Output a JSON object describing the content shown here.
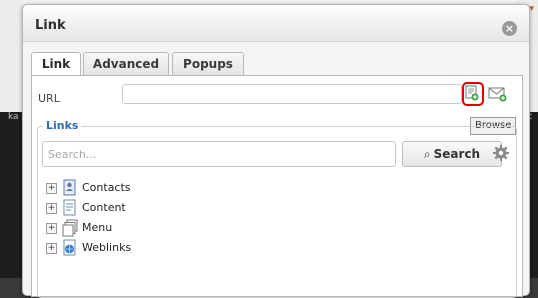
{
  "background": {
    "left_text": "ka",
    "right_text": "t"
  },
  "dialog": {
    "title": "Link",
    "close_glyph": "×"
  },
  "tabs": [
    {
      "label": "Link",
      "active": true
    },
    {
      "label": "Advanced",
      "active": false
    },
    {
      "label": "Popups",
      "active": false
    }
  ],
  "url": {
    "label": "URL",
    "value": "",
    "browse_icon": "browse-icon",
    "email_icon": "email-icon",
    "tooltip": "Browse"
  },
  "links": {
    "legend": "Links",
    "search_placeholder": "Search...",
    "search_button": "Search",
    "search_glyph": "⌕",
    "tree": [
      {
        "label": "Contacts",
        "icon": "contacts-icon"
      },
      {
        "label": "Content",
        "icon": "content-icon"
      },
      {
        "label": "Menu",
        "icon": "menu-icon"
      },
      {
        "label": "Weblinks",
        "icon": "weblinks-icon"
      }
    ]
  },
  "colors": {
    "legend_blue": "#2a6fb3",
    "browse_highlight": "#e00000"
  }
}
